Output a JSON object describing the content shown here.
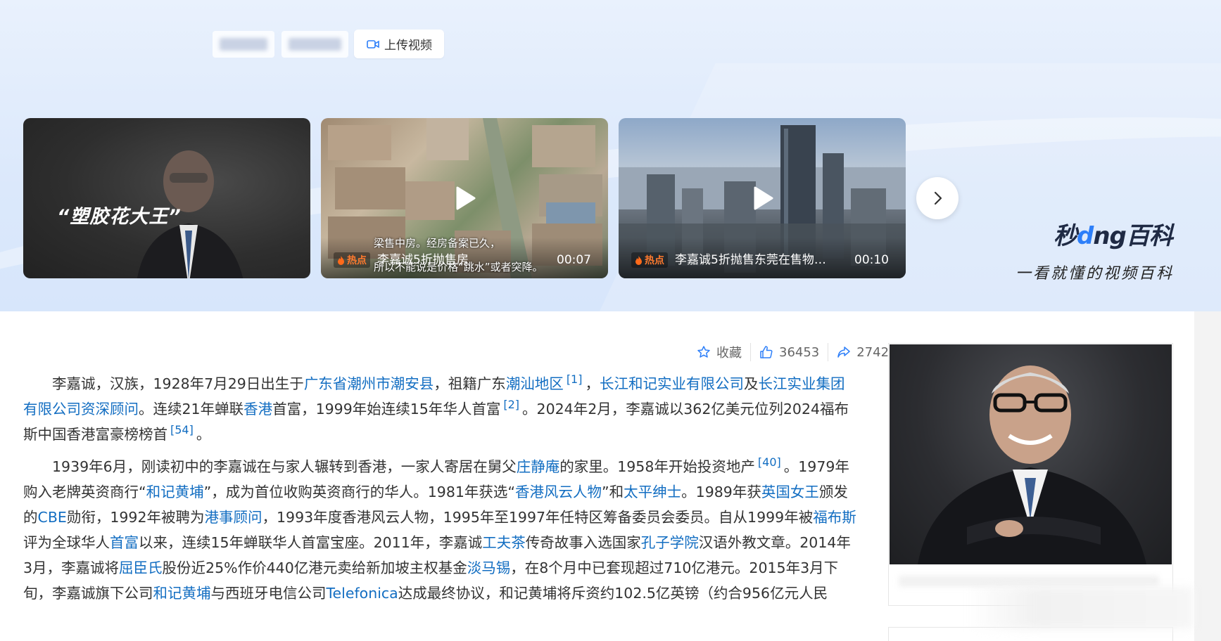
{
  "header": {
    "tabs_blurred": [
      "",
      ""
    ],
    "upload_label": "上传视频"
  },
  "videos": [
    {
      "overlay_title": "“塑胶花大王”",
      "hot": "",
      "caption": "",
      "duration": ""
    },
    {
      "overlay_title": "",
      "hot": "热点",
      "caption": "李嘉诚5折抛售房",
      "subtitle_1": "梁售中房。经房备案已久，",
      "subtitle_2": "所以不能说是价格“跳水”或者突降。",
      "duration": "00:07"
    },
    {
      "overlay_title": "",
      "hot": "热点",
      "caption": "李嘉诚5折抛售东莞在售物业...",
      "duration": "00:10"
    }
  ],
  "brand": {
    "logo_a": "秒",
    "logo_b": "d",
    "logo_c": "ng",
    "logo_d": "百科",
    "slogan": "一看就懂的视频百科"
  },
  "actions": {
    "favorite": "收藏",
    "likes": "36453",
    "shares": "2742"
  },
  "article": {
    "p1": {
      "t1": "李嘉诚，汉族，1928年7月29日出生于",
      "l1": "广东省潮州市潮安县",
      "t2": "，祖籍广东",
      "l2": "潮汕地区",
      "s1": "[1]",
      "t3": "，",
      "l3": "长江和记实业有限公司",
      "t4": "及",
      "l4": "长江实业集团有限公司资深顾问",
      "t5": "。连续21年蝉联",
      "l5": "香港",
      "t6": "首富，1999年始连续15年华人首富",
      "s2": "[2]",
      "t7": "。2024年2月，李嘉诚以362亿美元位列2024福布斯中国香港富豪榜榜首",
      "s3": "[54]",
      "t8": "。"
    },
    "p2": {
      "t1": "1939年6月，刚读初中的李嘉诚在与家人辗转到香港，一家人寄居在舅父",
      "l1": "庄静庵",
      "t2": "的家里。1958年开始投资地产",
      "s1": "[40]",
      "t3": "。1979年购入老牌英资商行“",
      "l2": "和记黄埔",
      "t4": "”，成为首位收购英资商行的华人。1981年获选“",
      "l3": "香港风云人物",
      "t5": "”和",
      "l4": "太平绅士",
      "t6": "。1989年获",
      "l5": "英国女王",
      "t7": "颁发的",
      "l6": "CBE",
      "t8": "勋衔，1992年被聘为",
      "l7": "港事顾问",
      "t9": "，1993年度香港风云人物，1995年至1997年任特区筹备委员会委员。自从1999年被",
      "l8": "福布斯",
      "t10": "评为全球华人",
      "l9": "首富",
      "t11": "以来，连续15年蝉联华人首富宝座。2011年，李嘉诚",
      "l10": "工夫茶",
      "t12": "传奇故事入选国家",
      "l11": "孔子学院",
      "t13": "汉语外教文章。2014年3月，李嘉诚将",
      "l12": "屈臣氏",
      "t14": "股份近25%作价440亿港元卖给新加坡主权基金",
      "l13": "淡马锡",
      "t15": "，在8个月中已套现超过710亿港元。2015年3月下旬，李嘉诚旗下公司",
      "l14": "和记黄埔",
      "t16": "与西班牙电信公司",
      "l15": "Telefonica",
      "t17": "达成最终协议，和记黄埔将斥资约102.5亿英镑（约合956亿元人民"
    }
  },
  "icons": [
    "video-camera-icon",
    "play-icon",
    "fire-icon",
    "chevron-right-icon",
    "star-icon",
    "thumbs-up-icon",
    "share-icon"
  ],
  "colors": {
    "link": "#136ec2",
    "hot": "#ff7a2e",
    "banner_bg": "#dbe8fb"
  }
}
